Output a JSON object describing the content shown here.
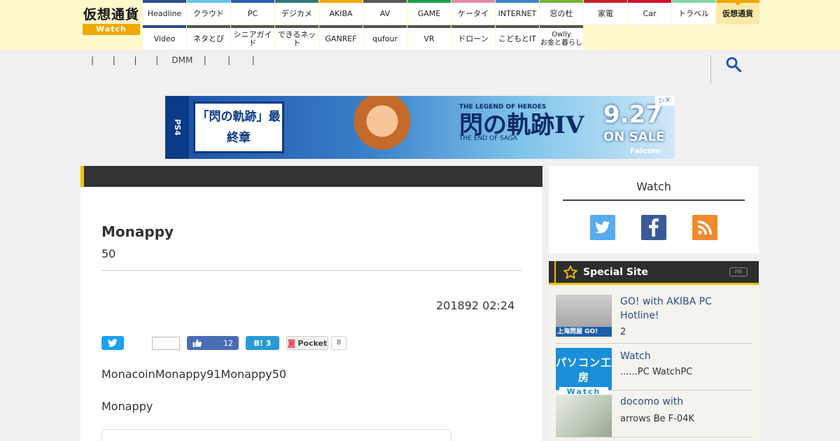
{
  "header": {
    "logo_text": "仮想通貨",
    "logo_sub": "Watch",
    "nav_row1": [
      {
        "label": "Headline",
        "color": "#2a4b8d"
      },
      {
        "label": "クラウド",
        "color": "#66c4e6"
      },
      {
        "label": "PC",
        "color": "#2a5db0"
      },
      {
        "label": "デジカメ",
        "color": "#2d7a74"
      },
      {
        "label": "AKIBA",
        "color": "#f0a800"
      },
      {
        "label": "AV",
        "color": "#555555"
      },
      {
        "label": "GAME",
        "color": "#1aa04a"
      },
      {
        "label": "ケータイ",
        "color": "#e48aa8"
      },
      {
        "label": "INTERNET",
        "color": "#3a86c9"
      },
      {
        "label": "窓の杜",
        "color": "#7ab23a"
      },
      {
        "label": "家電",
        "color": "#c9202a"
      },
      {
        "label": "Car",
        "color": "#d0102a"
      },
      {
        "label": "トラベル",
        "color": "#7fd4b0"
      },
      {
        "label": "仮想通貨",
        "color": "#f0a800"
      }
    ],
    "nav_row2": [
      {
        "label": "Video",
        "color": "#2a4b8d"
      },
      {
        "label": "ネタとぴ",
        "color": "#555555"
      },
      {
        "label": "シニアガイド",
        "color": "#555555"
      },
      {
        "label": "できるネット",
        "color": "#555555"
      },
      {
        "label": "GANREF",
        "color": "#555555"
      },
      {
        "label": "qufour",
        "color": "#555555"
      },
      {
        "label": "VR",
        "color": "#555555"
      },
      {
        "label": "ドローン",
        "color": "#555555"
      },
      {
        "label": "こどもとIT",
        "color": "#555555"
      },
      {
        "label": "Owlly お金と暮らし",
        "color": "#555555"
      }
    ]
  },
  "subnav": {
    "items": [
      "|",
      "|",
      "|",
      "|",
      "DMM",
      "|",
      "|",
      "|"
    ]
  },
  "ad": {
    "platform": "PS4",
    "title_left": "「閃の軌跡」最終章",
    "series": "THE LEGEND OF HEROES",
    "title_right": "閃の軌跡IV",
    "subtitle": "THE END OF SAGA",
    "date": "9.27",
    "onsale": "ON SALE",
    "brand": "Falcom",
    "close_label": "▷✕"
  },
  "article": {
    "title": "Monappy",
    "subtitle": "50",
    "date": "201892 02:24",
    "share": {
      "facebook_count": "12",
      "hatena_label": "B!",
      "hatena_count": "3",
      "pocket_label": "Pocket",
      "pocket_count": "8"
    },
    "p1": "MonacoinMonappy91Monappy50",
    "p2": "Monappy"
  },
  "sidebar": {
    "social_title": "Watch",
    "special_title": "Special Site",
    "special_pr": "PR",
    "items": [
      {
        "title": "GO! with AKIBA PC Hotline!",
        "desc": "2",
        "thumb_label": "上海問屋 GO!"
      },
      {
        "title": " Watch",
        "desc": "......PC WatchPC",
        "thumb_label_1": "パソコン工房",
        "thumb_label_2": "Watch"
      },
      {
        "title": "docomo with",
        "desc": "arrows Be F-04K"
      }
    ]
  }
}
